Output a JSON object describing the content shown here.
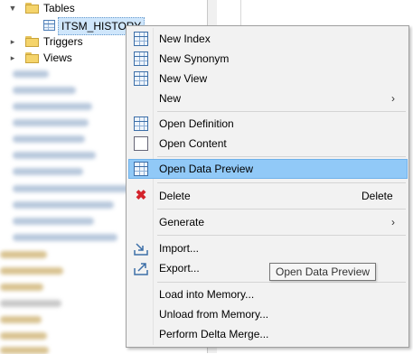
{
  "tree": {
    "tables_label": "Tables",
    "selected_table": "ITSM_HISTORY",
    "triggers_label": "Triggers",
    "views_label": "Views"
  },
  "menu": {
    "new_index": "New Index",
    "new_synonym": "New Synonym",
    "new_view": "New View",
    "new": "New",
    "open_definition": "Open Definition",
    "open_content": "Open Content",
    "open_data_preview": "Open Data Preview",
    "delete": "Delete",
    "delete_shortcut": "Delete",
    "generate": "Generate",
    "import": "Import...",
    "export": "Export...",
    "load_into_memory": "Load into Memory...",
    "unload_from_memory": "Unload from Memory...",
    "perform_delta_merge": "Perform Delta Merge..."
  },
  "tooltip": "Open Data Preview",
  "colors": {
    "highlight": "#91c9f7",
    "selection": "#cfe6fb",
    "delete_icon": "#d4232b"
  }
}
